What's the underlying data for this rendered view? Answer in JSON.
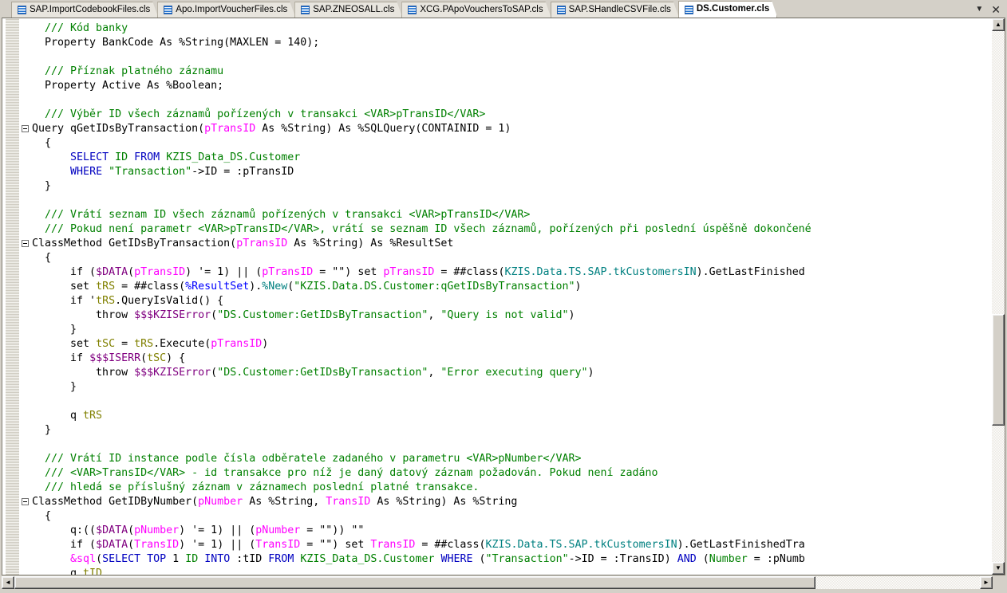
{
  "window": {
    "app": "Caché Studio code editor",
    "tab_controls": {
      "dropdown": "▼",
      "close": "✕"
    }
  },
  "tabs": [
    {
      "label": "SAP.ImportCodebookFiles.cls",
      "icon": "class-file-icon",
      "active": false
    },
    {
      "label": "Apo.ImportVoucherFiles.cls",
      "icon": "class-file-icon",
      "active": false
    },
    {
      "label": "SAP.ZNEOSALL.cls",
      "icon": "class-file-icon",
      "active": false
    },
    {
      "label": "XCG.PApoVouchersToSAP.cls",
      "icon": "class-file-icon",
      "active": false
    },
    {
      "label": "SAP.SHandleCSVFile.cls",
      "icon": "class-file-icon",
      "active": false
    },
    {
      "label": "DS.Customer.cls",
      "icon": "class-file-icon",
      "active": true
    }
  ],
  "colors": {
    "comment": "#008000",
    "keyword": "#000000",
    "parameter": "#ff00ff",
    "local_variable": "#808000",
    "string": "#008000",
    "class_name": "#008080",
    "sql_keyword": "#0000c0",
    "macro": "#800080",
    "system_class": "#0000ff",
    "editor_background": "#ffffff",
    "chrome_background": "#d4d0c8"
  },
  "code": {
    "language": "Cache ObjectScript",
    "lines": [
      {
        "fold": false,
        "tokens": [
          {
            "t": "  ",
            "c": "plain"
          },
          {
            "t": "/// Kód banky",
            "c": "com"
          }
        ]
      },
      {
        "fold": false,
        "tokens": [
          {
            "t": "  Property BankCode As %String(MAXLEN = 140);",
            "c": "plain"
          }
        ]
      },
      {
        "fold": false,
        "tokens": [
          {
            "t": "",
            "c": "plain"
          }
        ]
      },
      {
        "fold": false,
        "tokens": [
          {
            "t": "  ",
            "c": "plain"
          },
          {
            "t": "/// Příznak platného záznamu",
            "c": "com"
          }
        ]
      },
      {
        "fold": false,
        "tokens": [
          {
            "t": "  Property Active As %Boolean;",
            "c": "plain"
          }
        ]
      },
      {
        "fold": false,
        "tokens": [
          {
            "t": "",
            "c": "plain"
          }
        ]
      },
      {
        "fold": false,
        "tokens": [
          {
            "t": "  ",
            "c": "plain"
          },
          {
            "t": "/// Výběr ID všech záznamů pořízených v transakci <VAR>pTransID</VAR>",
            "c": "com"
          }
        ]
      },
      {
        "fold": true,
        "tokens": [
          {
            "t": "Query qGetIDsByTransaction(",
            "c": "plain"
          },
          {
            "t": "pTransID",
            "c": "param"
          },
          {
            "t": " As %String) As %SQLQuery(CONTAINID = 1)",
            "c": "plain"
          }
        ]
      },
      {
        "fold": false,
        "tokens": [
          {
            "t": "  {",
            "c": "plain"
          }
        ]
      },
      {
        "fold": false,
        "tokens": [
          {
            "t": "      ",
            "c": "plain"
          },
          {
            "t": "SELECT",
            "c": "sql"
          },
          {
            "t": " ",
            "c": "plain"
          },
          {
            "t": "ID",
            "c": "sqlid"
          },
          {
            "t": " ",
            "c": "plain"
          },
          {
            "t": "FROM",
            "c": "sql"
          },
          {
            "t": " ",
            "c": "plain"
          },
          {
            "t": "KZIS_Data_DS.Customer",
            "c": "sqlid"
          }
        ]
      },
      {
        "fold": false,
        "tokens": [
          {
            "t": "      ",
            "c": "plain"
          },
          {
            "t": "WHERE",
            "c": "sql"
          },
          {
            "t": " ",
            "c": "plain"
          },
          {
            "t": "\"Transaction\"",
            "c": "str"
          },
          {
            "t": "->ID = :pTransID",
            "c": "plain"
          }
        ]
      },
      {
        "fold": false,
        "tokens": [
          {
            "t": "  }",
            "c": "plain"
          }
        ]
      },
      {
        "fold": false,
        "tokens": [
          {
            "t": "",
            "c": "plain"
          }
        ]
      },
      {
        "fold": false,
        "tokens": [
          {
            "t": "  ",
            "c": "plain"
          },
          {
            "t": "/// Vrátí seznam ID všech záznamů pořízených v transakci <VAR>pTransID</VAR>",
            "c": "com"
          }
        ]
      },
      {
        "fold": false,
        "tokens": [
          {
            "t": "  ",
            "c": "plain"
          },
          {
            "t": "/// Pokud není parametr <VAR>pTransID</VAR>, vrátí se seznam ID všech záznamů, pořízených při poslední úspěšně dokončené",
            "c": "com"
          }
        ]
      },
      {
        "fold": true,
        "tokens": [
          {
            "t": "ClassMethod GetIDsByTransaction(",
            "c": "plain"
          },
          {
            "t": "pTransID",
            "c": "param"
          },
          {
            "t": " As %String) As %ResultSet",
            "c": "plain"
          }
        ]
      },
      {
        "fold": false,
        "tokens": [
          {
            "t": "  {",
            "c": "plain"
          }
        ]
      },
      {
        "fold": false,
        "tokens": [
          {
            "t": "      if (",
            "c": "plain"
          },
          {
            "t": "$DATA",
            "c": "macro"
          },
          {
            "t": "(",
            "c": "plain"
          },
          {
            "t": "pTransID",
            "c": "param"
          },
          {
            "t": ") '= 1) || (",
            "c": "plain"
          },
          {
            "t": "pTransID",
            "c": "param"
          },
          {
            "t": " = \"\") set ",
            "c": "plain"
          },
          {
            "t": "pTransID",
            "c": "param"
          },
          {
            "t": " = ##class(",
            "c": "plain"
          },
          {
            "t": "KZIS.Data.TS.SAP.tkCustomersIN",
            "c": "cls"
          },
          {
            "t": ").GetLastFinished",
            "c": "plain"
          }
        ]
      },
      {
        "fold": false,
        "tokens": [
          {
            "t": "      set ",
            "c": "plain"
          },
          {
            "t": "tRS",
            "c": "var"
          },
          {
            "t": " = ##class(",
            "c": "plain"
          },
          {
            "t": "%ResultSet",
            "c": "sys"
          },
          {
            "t": ").",
            "c": "plain"
          },
          {
            "t": "%New",
            "c": "meth"
          },
          {
            "t": "(",
            "c": "plain"
          },
          {
            "t": "\"KZIS.Data.DS.Customer:qGetIDsByTransaction\"",
            "c": "str"
          },
          {
            "t": ")",
            "c": "plain"
          }
        ]
      },
      {
        "fold": false,
        "tokens": [
          {
            "t": "      if '",
            "c": "plain"
          },
          {
            "t": "tRS",
            "c": "var"
          },
          {
            "t": ".QueryIsValid() {",
            "c": "plain"
          }
        ]
      },
      {
        "fold": false,
        "tokens": [
          {
            "t": "          throw ",
            "c": "plain"
          },
          {
            "t": "$$$KZISError",
            "c": "macro"
          },
          {
            "t": "(",
            "c": "plain"
          },
          {
            "t": "\"DS.Customer:GetIDsByTransaction\"",
            "c": "str"
          },
          {
            "t": ", ",
            "c": "plain"
          },
          {
            "t": "\"Query is not valid\"",
            "c": "str"
          },
          {
            "t": ")",
            "c": "plain"
          }
        ]
      },
      {
        "fold": false,
        "tokens": [
          {
            "t": "      }",
            "c": "plain"
          }
        ]
      },
      {
        "fold": false,
        "tokens": [
          {
            "t": "      set ",
            "c": "plain"
          },
          {
            "t": "tSC",
            "c": "var"
          },
          {
            "t": " = ",
            "c": "plain"
          },
          {
            "t": "tRS",
            "c": "var"
          },
          {
            "t": ".Execute(",
            "c": "plain"
          },
          {
            "t": "pTransID",
            "c": "param"
          },
          {
            "t": ")",
            "c": "plain"
          }
        ]
      },
      {
        "fold": false,
        "tokens": [
          {
            "t": "      if ",
            "c": "plain"
          },
          {
            "t": "$$$ISERR",
            "c": "macro"
          },
          {
            "t": "(",
            "c": "plain"
          },
          {
            "t": "tSC",
            "c": "var"
          },
          {
            "t": ") {",
            "c": "plain"
          }
        ]
      },
      {
        "fold": false,
        "tokens": [
          {
            "t": "          throw ",
            "c": "plain"
          },
          {
            "t": "$$$KZISError",
            "c": "macro"
          },
          {
            "t": "(",
            "c": "plain"
          },
          {
            "t": "\"DS.Customer:GetIDsByTransaction\"",
            "c": "str"
          },
          {
            "t": ", ",
            "c": "plain"
          },
          {
            "t": "\"Error executing query\"",
            "c": "str"
          },
          {
            "t": ")",
            "c": "plain"
          }
        ]
      },
      {
        "fold": false,
        "tokens": [
          {
            "t": "      }",
            "c": "plain"
          }
        ]
      },
      {
        "fold": false,
        "tokens": [
          {
            "t": "",
            "c": "plain"
          }
        ]
      },
      {
        "fold": false,
        "tokens": [
          {
            "t": "      q ",
            "c": "plain"
          },
          {
            "t": "tRS",
            "c": "var"
          }
        ]
      },
      {
        "fold": false,
        "tokens": [
          {
            "t": "  }",
            "c": "plain"
          }
        ]
      },
      {
        "fold": false,
        "tokens": [
          {
            "t": "",
            "c": "plain"
          }
        ]
      },
      {
        "fold": false,
        "tokens": [
          {
            "t": "  ",
            "c": "plain"
          },
          {
            "t": "/// Vrátí ID instance podle čísla odběratele zadaného v parametru <VAR>pNumber</VAR>",
            "c": "com"
          }
        ]
      },
      {
        "fold": false,
        "tokens": [
          {
            "t": "  ",
            "c": "plain"
          },
          {
            "t": "/// <VAR>TransID</VAR> - id transakce pro níž je daný datový záznam požadován. Pokud není zadáno",
            "c": "com"
          }
        ]
      },
      {
        "fold": false,
        "tokens": [
          {
            "t": "  ",
            "c": "plain"
          },
          {
            "t": "/// hledá se příslušný záznam v záznamech poslední platné transakce.",
            "c": "com"
          }
        ]
      },
      {
        "fold": true,
        "tokens": [
          {
            "t": "ClassMethod GetIDByNumber(",
            "c": "plain"
          },
          {
            "t": "pNumber",
            "c": "param"
          },
          {
            "t": " As %String, ",
            "c": "plain"
          },
          {
            "t": "TransID",
            "c": "param"
          },
          {
            "t": " As %String) As %String",
            "c": "plain"
          }
        ]
      },
      {
        "fold": false,
        "tokens": [
          {
            "t": "  {",
            "c": "plain"
          }
        ]
      },
      {
        "fold": false,
        "tokens": [
          {
            "t": "      q:((",
            "c": "plain"
          },
          {
            "t": "$DATA",
            "c": "macro"
          },
          {
            "t": "(",
            "c": "plain"
          },
          {
            "t": "pNumber",
            "c": "param"
          },
          {
            "t": ") '= 1) || (",
            "c": "plain"
          },
          {
            "t": "pNumber",
            "c": "param"
          },
          {
            "t": " = \"\")) \"\"",
            "c": "plain"
          }
        ]
      },
      {
        "fold": false,
        "tokens": [
          {
            "t": "      if (",
            "c": "plain"
          },
          {
            "t": "$DATA",
            "c": "macro"
          },
          {
            "t": "(",
            "c": "plain"
          },
          {
            "t": "TransID",
            "c": "param"
          },
          {
            "t": ") '= 1) || (",
            "c": "plain"
          },
          {
            "t": "TransID",
            "c": "param"
          },
          {
            "t": " = \"\") set ",
            "c": "plain"
          },
          {
            "t": "TransID",
            "c": "param"
          },
          {
            "t": " = ##class(",
            "c": "plain"
          },
          {
            "t": "KZIS.Data.TS.SAP.tkCustomersIN",
            "c": "cls"
          },
          {
            "t": ").GetLastFinishedTra",
            "c": "plain"
          }
        ]
      },
      {
        "fold": false,
        "tokens": [
          {
            "t": "      ",
            "c": "plain"
          },
          {
            "t": "&sql",
            "c": "param"
          },
          {
            "t": "(",
            "c": "plain"
          },
          {
            "t": "SELECT TOP",
            "c": "sql"
          },
          {
            "t": " 1 ",
            "c": "plain"
          },
          {
            "t": "ID",
            "c": "sqlid"
          },
          {
            "t": " ",
            "c": "plain"
          },
          {
            "t": "INTO",
            "c": "sql"
          },
          {
            "t": " :tID ",
            "c": "plain"
          },
          {
            "t": "FROM",
            "c": "sql"
          },
          {
            "t": " ",
            "c": "plain"
          },
          {
            "t": "KZIS_Data_DS.Customer",
            "c": "sqlid"
          },
          {
            "t": " ",
            "c": "plain"
          },
          {
            "t": "WHERE",
            "c": "sql"
          },
          {
            "t": " (",
            "c": "plain"
          },
          {
            "t": "\"Transaction\"",
            "c": "str"
          },
          {
            "t": "->ID = :TransID) ",
            "c": "plain"
          },
          {
            "t": "AND",
            "c": "sql"
          },
          {
            "t": " (",
            "c": "plain"
          },
          {
            "t": "Number",
            "c": "sqlid"
          },
          {
            "t": " = :pNumb",
            "c": "plain"
          }
        ]
      },
      {
        "fold": false,
        "tokens": [
          {
            "t": "      q ",
            "c": "plain"
          },
          {
            "t": "tID",
            "c": "var"
          }
        ]
      }
    ]
  },
  "scrollbars": {
    "vertical": {
      "up_arrow": "▲",
      "down_arrow": "▼"
    },
    "horizontal": {
      "left_arrow": "◄",
      "right_arrow": "►"
    }
  }
}
